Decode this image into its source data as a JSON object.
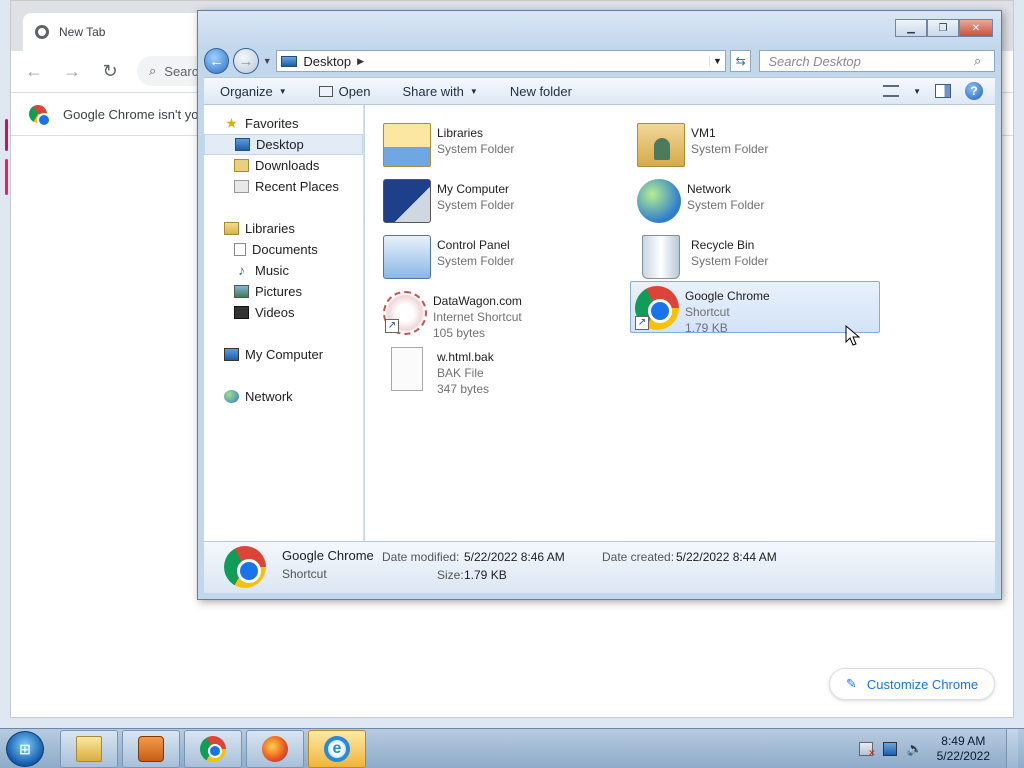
{
  "chrome": {
    "tab_title": "New Tab",
    "omnibox_placeholder": "Search",
    "infobar_text": "Google Chrome isn't yo",
    "customize_label": "Customize Chrome",
    "accent_colors": [
      "#c2185b",
      "#ad1457"
    ]
  },
  "explorer": {
    "address": "Desktop",
    "search_placeholder": "Search Desktop",
    "commands": {
      "organize": "Organize",
      "open": "Open",
      "share_with": "Share with",
      "new_folder": "New folder"
    },
    "nav": {
      "favorites": "Favorites",
      "favorites_items": [
        "Desktop",
        "Downloads",
        "Recent Places"
      ],
      "libraries": "Libraries",
      "libraries_items": [
        "Documents",
        "Music",
        "Pictures",
        "Videos"
      ],
      "my_computer": "My Computer",
      "network": "Network"
    },
    "items": [
      {
        "name": "Libraries",
        "sub1": "System Folder",
        "sub2": "",
        "icon": "libraries-icon"
      },
      {
        "name": "VM1",
        "sub1": "System Folder",
        "sub2": "",
        "icon": "user-folder-icon"
      },
      {
        "name": "My Computer",
        "sub1": "System Folder",
        "sub2": "",
        "icon": "computer-icon"
      },
      {
        "name": "Network",
        "sub1": "System Folder",
        "sub2": "",
        "icon": "network-icon"
      },
      {
        "name": "Control Panel",
        "sub1": "System Folder",
        "sub2": "",
        "icon": "control-panel-icon"
      },
      {
        "name": "Recycle Bin",
        "sub1": "System Folder",
        "sub2": "",
        "icon": "recycle-bin-icon"
      },
      {
        "name": "DataWagon.com",
        "sub1": "Internet Shortcut",
        "sub2": "105 bytes",
        "icon": "internet-shortcut-icon"
      },
      {
        "name": "Google Chrome",
        "sub1": "Shortcut",
        "sub2": "1.79 KB",
        "icon": "chrome-icon",
        "selected": true
      },
      {
        "name": "w.html.bak",
        "sub1": "BAK File",
        "sub2": "347 bytes",
        "icon": "file-icon"
      }
    ],
    "details": {
      "name": "Google Chrome",
      "type": "Shortcut",
      "date_modified_label": "Date modified:",
      "date_modified": "5/22/2022 8:46 AM",
      "date_created_label": "Date created:",
      "date_created": "5/22/2022 8:44 AM",
      "size_label": "Size:",
      "size": "1.79 KB"
    }
  },
  "taskbar": {
    "time": "8:49 AM",
    "date": "5/22/2022",
    "buttons": [
      "explorer-icon",
      "media-player-icon",
      "chrome-icon",
      "firefox-icon",
      "internet-explorer-icon"
    ]
  }
}
